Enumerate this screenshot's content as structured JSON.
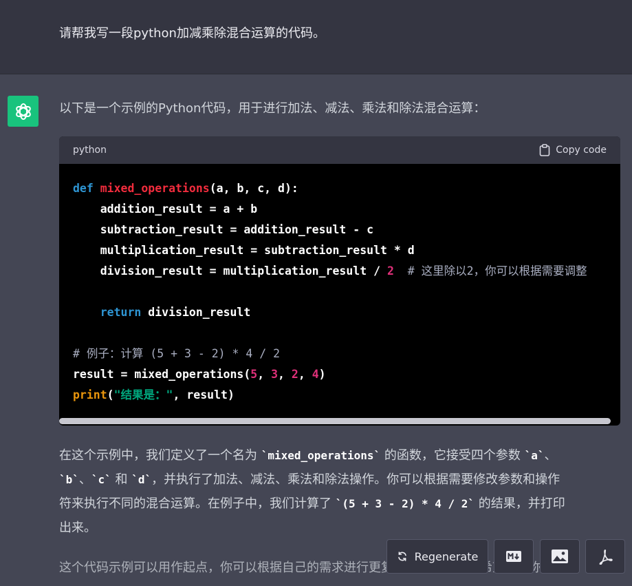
{
  "user_message": "请帮我写一段python加减乘除混合运算的代码。",
  "assistant": {
    "intro": "以下是一个示例的Python代码，用于进行加法、减法、乘法和除法混合运算：",
    "code_block": {
      "language": "python",
      "copy_label": "Copy code",
      "lines": {
        "l1_kw": "def",
        "l1_fn": "mixed_operations",
        "l1_rest": "(a, b, c, d):",
        "l2": "    addition_result = a + b",
        "l3": "    subtraction_result = addition_result - c",
        "l4": "    multiplication_result = subtraction_result * d",
        "l5_code": "    division_result = multiplication_result / ",
        "l5_num": "2",
        "l5_comment": "  # 这里除以2，你可以根据需要调整",
        "l7_indent": "    ",
        "l7_kw": "return",
        "l7_rest": " division_result",
        "l9_comment": "# 例子：计算 (5 + 3 - 2) * 4 / 2",
        "l10_a": "result = mixed_operations(",
        "l10_n1": "5",
        "l10_s1": ", ",
        "l10_n2": "3",
        "l10_s2": ", ",
        "l10_n3": "2",
        "l10_s3": ", ",
        "l10_n4": "4",
        "l10_b": ")",
        "l11_fn": "print",
        "l11_open": "(",
        "l11_str": "\"结果是：\"",
        "l11_rest": ", result)"
      }
    },
    "explanation": {
      "p1_a": "在这个示例中，我们定义了一个名为 ",
      "p1_code1": "`mixed_operations`",
      "p1_b": " 的函数，它接受四个参数 ",
      "p1_code2": "`a`",
      "p1_c": "、",
      "p2_code1": "`b`",
      "p2_a": "、",
      "p2_code2": "`c`",
      "p2_b": " 和 ",
      "p2_code3": "`d`",
      "p2_c": "，并执行了加法、减法、乘法和除法操作。你可以根据需要修改参数和操作",
      "p3_a": "符来执行不同的混合运算。在例子中，我们计算了 ",
      "p3_code": "`(5 + 3 - 2) * 4 / 2`",
      "p3_b": " 的结果，并打印",
      "p4": "出来。"
    },
    "partial_paragraph": "这个代码示例可以用作起点，你可以根据自己的需求进行更复杂的混合运算。希望这对你有"
  },
  "actions": {
    "regenerate_label": "Regenerate",
    "tools": [
      "markdown-icon",
      "image-icon",
      "pdf-icon"
    ]
  },
  "colors": {
    "user_bg": "#343541",
    "assistant_bg": "#444654",
    "avatar_bg": "#19c37d",
    "keyword": "#2e95d3",
    "function": "#f22c3d",
    "number": "#df3079",
    "builtin": "#e9950c",
    "string": "#00a67d"
  }
}
